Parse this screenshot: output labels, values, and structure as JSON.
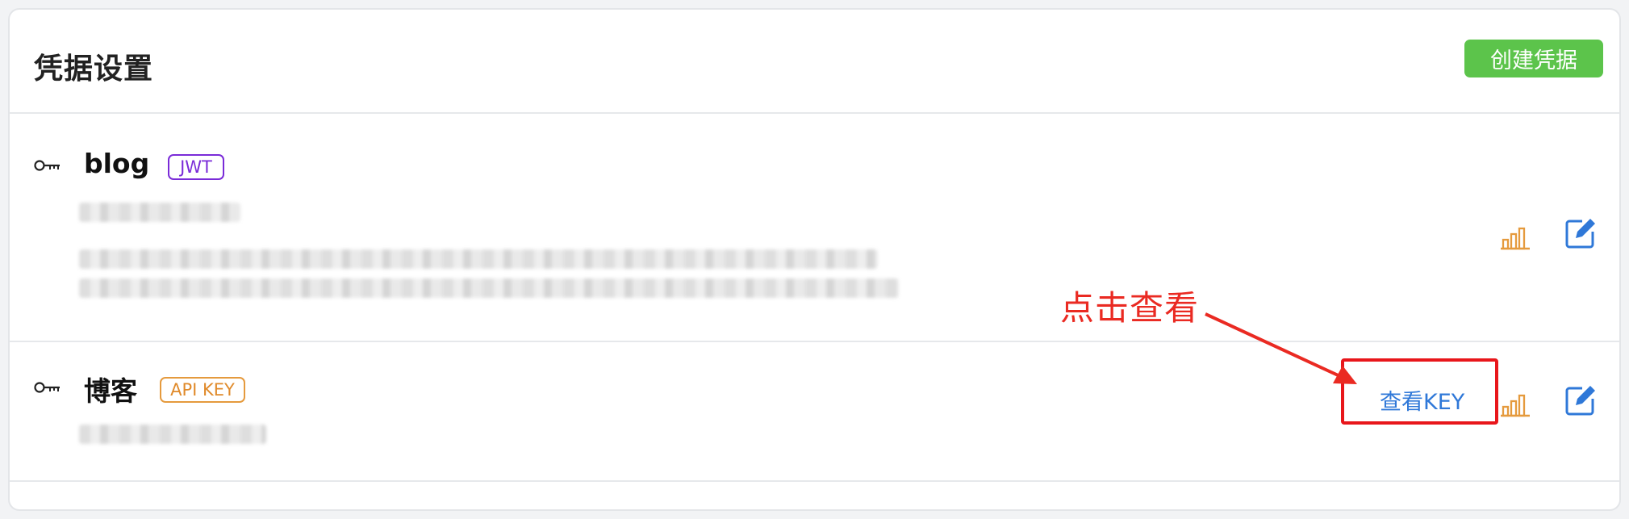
{
  "header": {
    "title": "凭据设置",
    "create_button_label": "创建凭据"
  },
  "credentials": [
    {
      "name": "blog",
      "type_tag": "JWT",
      "icon": "key-icon",
      "actions": [
        "stats-icon",
        "edit-icon"
      ]
    },
    {
      "name": "博客",
      "type_tag": "API KEY",
      "icon": "key-icon",
      "view_key_label": "查看KEY",
      "actions": [
        "stats-icon",
        "edit-icon"
      ]
    }
  ],
  "annotation": {
    "text": "点击查看",
    "color": "#ea2a22"
  },
  "colors": {
    "create_button": "#5cc44b",
    "jwt_tag": "#7a2bd8",
    "api_key_tag": "#e08a2a",
    "stats_icon": "#e59a3d",
    "edit_icon": "#2f78d8",
    "link": "#2f78d8"
  }
}
